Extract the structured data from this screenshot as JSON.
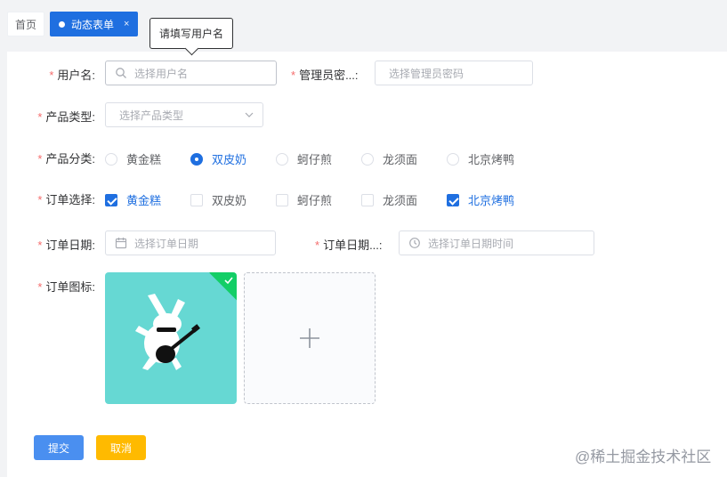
{
  "tabs": [
    {
      "label": "首页"
    },
    {
      "label": "动态表单",
      "close": "×"
    }
  ],
  "tooltip": {
    "text": "请填写用户名"
  },
  "form": {
    "username": {
      "label": "用户名:",
      "placeholder": "选择用户名"
    },
    "admin_password": {
      "label": "管理员密...:",
      "placeholder": "选择管理员密码"
    },
    "product_type": {
      "label": "产品类型:",
      "placeholder": "选择产品类型"
    },
    "product_category": {
      "label": "产品分类:",
      "options": [
        "黄金糕",
        "双皮奶",
        "蚵仔煎",
        "龙须面",
        "北京烤鸭"
      ],
      "selected": "双皮奶"
    },
    "order_select": {
      "label": "订单选择:",
      "options": [
        "黄金糕",
        "双皮奶",
        "蚵仔煎",
        "龙须面",
        "北京烤鸭"
      ],
      "checked": [
        "黄金糕",
        "北京烤鸭"
      ]
    },
    "order_date": {
      "label": "订单日期:",
      "placeholder": "选择订单日期"
    },
    "order_datetime": {
      "label": "订单日期...:",
      "placeholder": "选择订单日期时间"
    },
    "order_icon": {
      "label": "订单图标:"
    }
  },
  "actions": {
    "submit": "提交",
    "cancel": "取消"
  },
  "watermark": "@稀土掘金技术社区",
  "colors": {
    "primary": "#1f6fe0",
    "required": "#f56c6c",
    "success": "#13ce66",
    "cancel": "#ffba00"
  }
}
